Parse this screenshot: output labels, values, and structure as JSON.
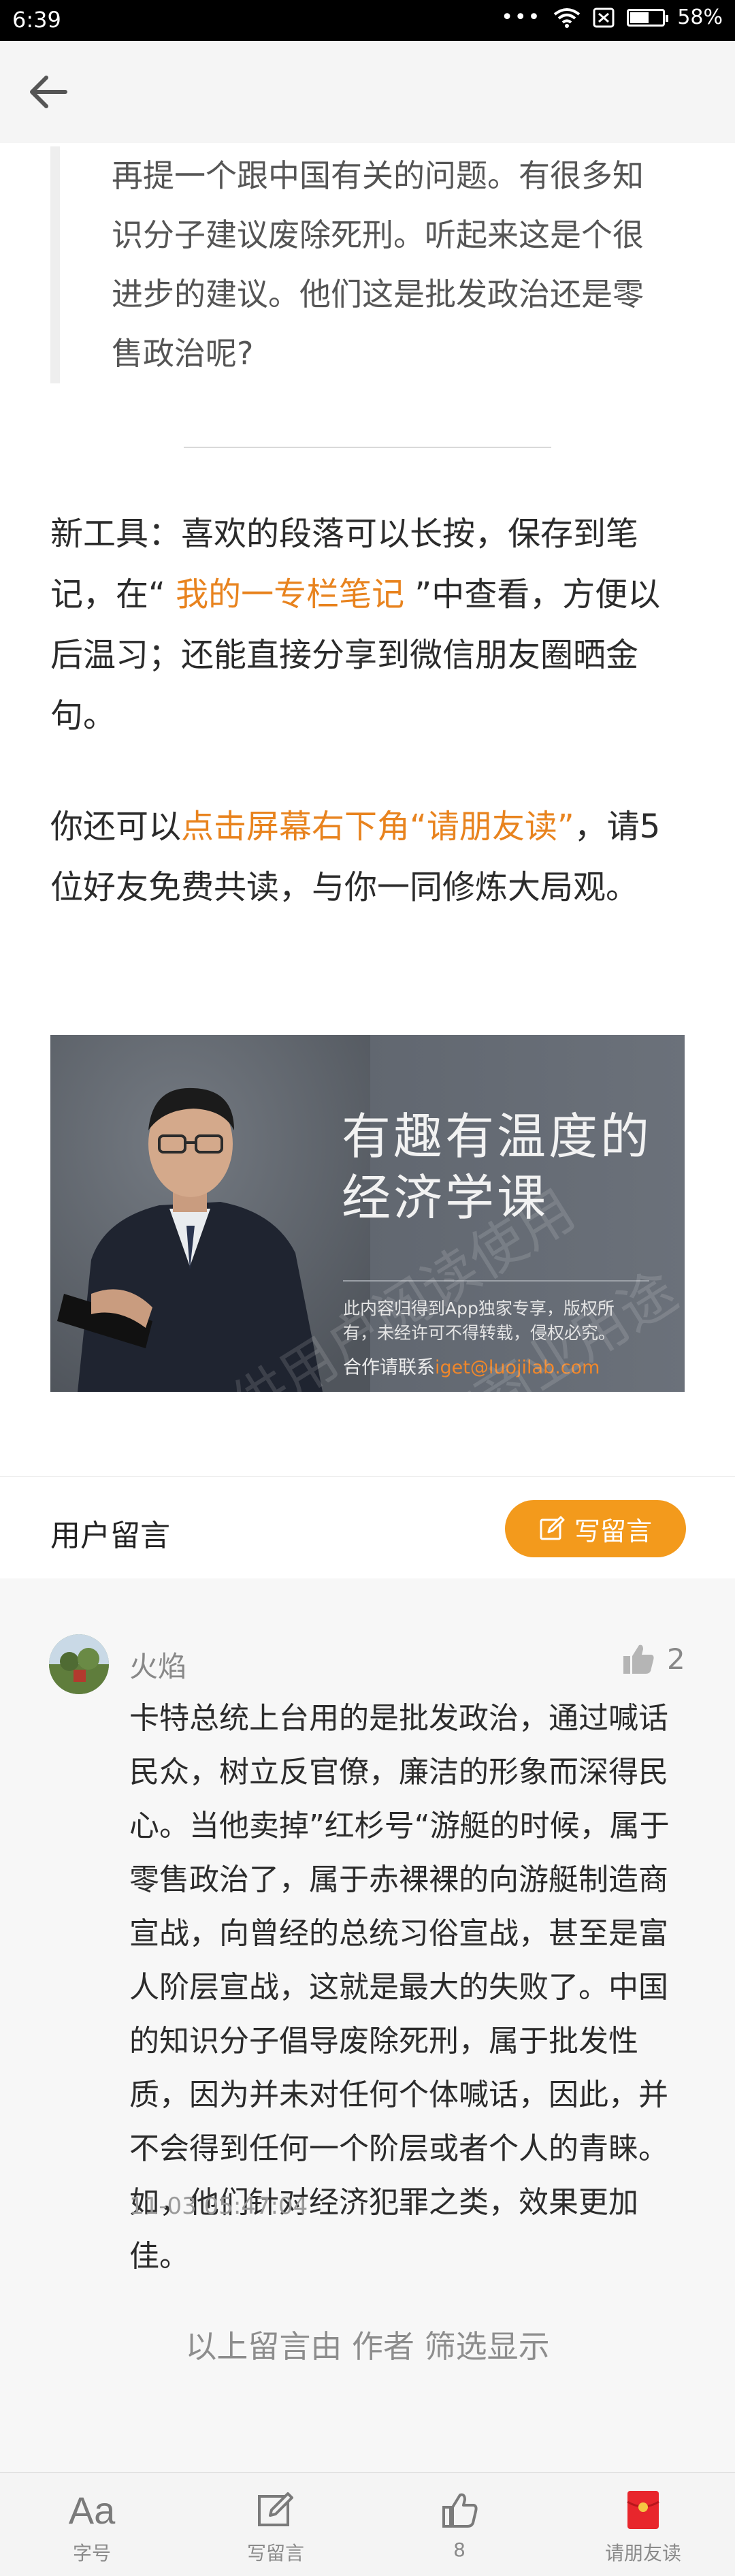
{
  "status_bar": {
    "time": "6:39",
    "dots": "•••",
    "battery_percent": "58%",
    "battery_level": 0.58
  },
  "nav": {
    "back_icon": "arrow-left-icon"
  },
  "article": {
    "quote_lines": [
      "再提一个跟中国有关的问题。有很多知",
      "识分子建议废除死刑。听起来这是个很",
      "进步的建议。他们这是批发政治还是零",
      "售政治呢?"
    ],
    "tip": {
      "before": "新工具：喜欢的段落可以长按，保存到笔记，在“",
      "link": " 我的一专栏笔记 ",
      "after": "”中查看，方便以后温习；还能直接分享到微信朋友圈晒金句。"
    },
    "share": {
      "before": "你还可以",
      "link": "点击屏幕右下角“请朋友读”",
      "after": "，请5位好友免费共读，与你一同修炼大局观。"
    }
  },
  "banner": {
    "title_line1": "有趣有温度的",
    "title_line2": "经济学课",
    "copyright_line1": "此内容归得到App独家专享，版权所",
    "copyright_line2": "有，未经许可不得转载，侵权必究。",
    "contact_label": "合作请联系",
    "contact_email": "iget@luojilab.com",
    "watermark_line1": "仅供用户阅读使用",
    "watermark_line2": "请勿用作商业用途"
  },
  "comments": {
    "title": "用户留言",
    "write_button": "写留言",
    "items": [
      {
        "user": "火焰",
        "likes": "2",
        "text": "卡特总统上台用的是批发政治，通过喊话民众，树立反官僚，廉洁的形象而深得民心。当他卖掉”红杉号“游艇的时候，属于零售政治了，属于赤裸裸的向游艇制造商宣战，向曾经的总统习俗宣战，甚至是富人阶层宣战，这就是最大的失败了。中国的知识分子倡导废除死刑，属于批发性质，因为并未对任何个体喊话，因此，并不会得到任何一个阶层或者个人的青睐。如，他们针对经济犯罪之类，效果更加佳。",
        "time": "11-03 05:47:04"
      }
    ],
    "filter_note": "以上留言由 作者 筛选显示"
  },
  "toolbar": {
    "font_icon_text": "Aa",
    "font_label": "字号",
    "write_label": "写留言",
    "like_count": "8",
    "share_label": "请朋友读"
  },
  "colors": {
    "accent": "#e8831e",
    "button": "#f39a1c",
    "share_icon": "#e8262c"
  }
}
